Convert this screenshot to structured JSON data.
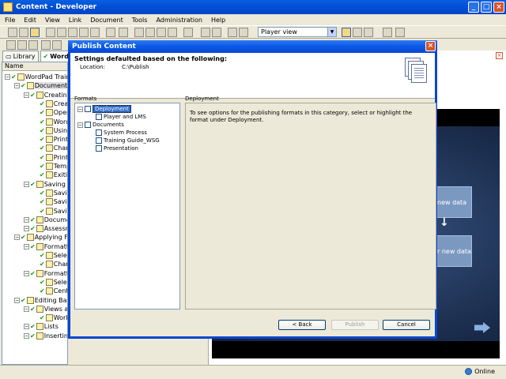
{
  "app": {
    "title": "Content - Developer"
  },
  "menu": [
    "File",
    "Edit",
    "View",
    "Link",
    "Document",
    "Tools",
    "Administration",
    "Help"
  ],
  "toolbar": {
    "view_select": "Player view"
  },
  "tabs": [
    {
      "label": "Library"
    },
    {
      "label": "Word"
    }
  ],
  "tree": {
    "header": "Name",
    "rows": [
      {
        "label": "WordPad Training",
        "level": 0
      },
      {
        "label": "Document Ba",
        "level": 1
      },
      {
        "label": "Creating",
        "level": 2
      },
      {
        "label": "Creat",
        "level": 3
      },
      {
        "label": "Open",
        "level": 3
      },
      {
        "label": "Word",
        "level": 3
      },
      {
        "label": "Using",
        "level": 3
      },
      {
        "label": "Print F",
        "level": 3
      },
      {
        "label": "Chang",
        "level": 3
      },
      {
        "label": "Printi",
        "level": 3
      },
      {
        "label": "Templ",
        "level": 3
      },
      {
        "label": "Exitin",
        "level": 3
      },
      {
        "label": "Saving D",
        "level": 2
      },
      {
        "label": "Savin",
        "level": 3
      },
      {
        "label": "Savin",
        "level": 3
      },
      {
        "label": "Savin",
        "level": 3
      },
      {
        "label": "Document",
        "level": 2
      },
      {
        "label": "Assessme",
        "level": 2
      },
      {
        "label": "Applying For",
        "level": 1
      },
      {
        "label": "Formattin",
        "level": 2
      },
      {
        "label": "Select",
        "level": 3
      },
      {
        "label": "Chang",
        "level": 3
      },
      {
        "label": "Formattin",
        "level": 2
      },
      {
        "label": "Select",
        "level": 3
      },
      {
        "label": "Cente",
        "level": 3
      },
      {
        "label": "Editing Basic",
        "level": 1
      },
      {
        "label": "Views and",
        "level": 2
      },
      {
        "label": "Work",
        "level": 3
      },
      {
        "label": "Lists",
        "level": 2
      },
      {
        "label": "Inserting",
        "level": 2
      }
    ]
  },
  "slide": {
    "box1": "new data",
    "box2": "r new data"
  },
  "status": {
    "online": "Online"
  },
  "dialog": {
    "title": "Publish Content",
    "heading": "Settings defaulted based on the following:",
    "location_label": "Location:",
    "location_value": "C:\\Publish",
    "formats_label": "Formats",
    "formats": {
      "deployment": "Deployment",
      "player_lms": "Player and LMS",
      "documents": "Documents",
      "system_process": "System Process",
      "training_guide": "Training Guide_WSG",
      "presentation": "Presentation"
    },
    "deployment_label": "Deployment",
    "deployment_text": "To see options for the publishing formats in this category, select or highlight the format under Deployment.",
    "back_label": "< Back",
    "publish_label": "Publish",
    "cancel_label": "Cancel"
  }
}
